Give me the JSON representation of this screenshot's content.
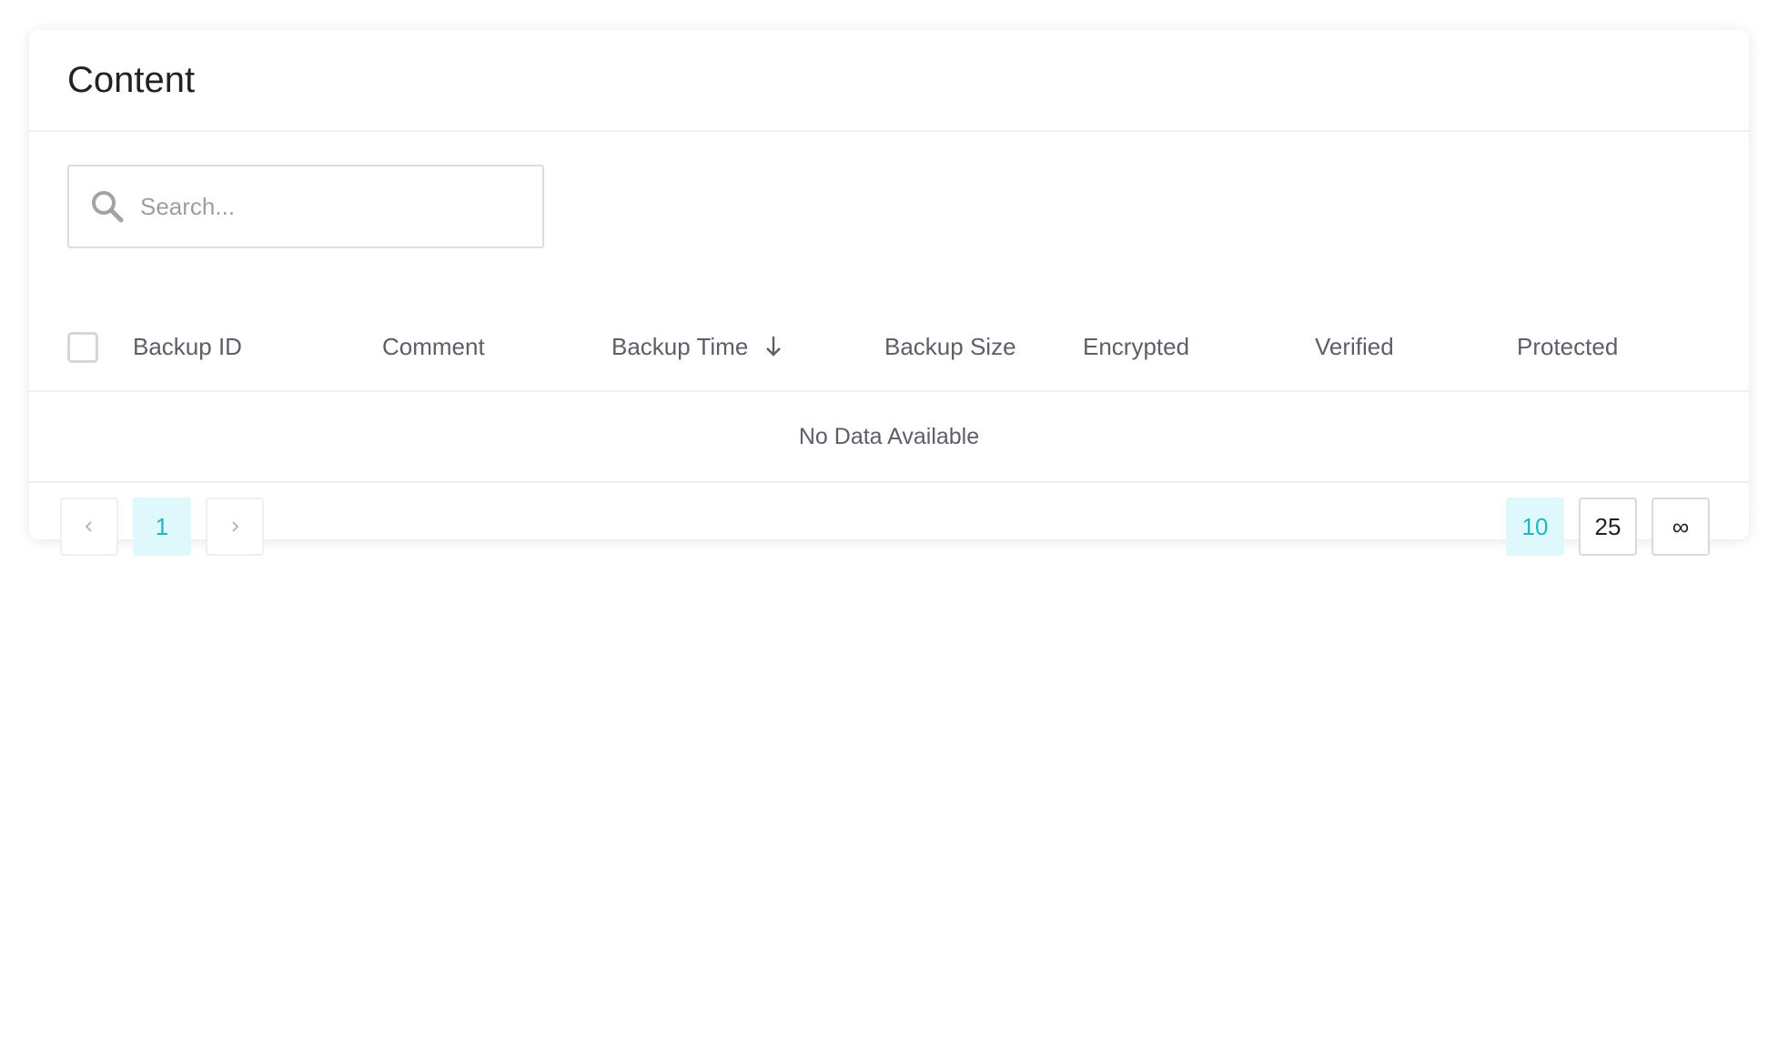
{
  "card": {
    "title": "Content"
  },
  "search": {
    "placeholder": "Search..."
  },
  "table": {
    "columns": [
      {
        "label": "Backup ID"
      },
      {
        "label": "Comment"
      },
      {
        "label": "Backup Time",
        "sorted": "desc"
      },
      {
        "label": "Backup Size"
      },
      {
        "label": "Encrypted"
      },
      {
        "label": "Verified"
      },
      {
        "label": "Protected"
      }
    ],
    "empty_text": "No Data Available"
  },
  "pagination": {
    "prev_icon": "chevron-left-icon",
    "next_icon": "chevron-right-icon",
    "pages": [
      "1"
    ],
    "current_page": "1",
    "page_sizes": [
      "10",
      "25",
      "∞"
    ],
    "selected_page_size": "10"
  },
  "colors": {
    "accent": "#22b5c3",
    "accent_bg": "#dff8fb",
    "text": "#5b6068",
    "title": "#1f2326"
  }
}
